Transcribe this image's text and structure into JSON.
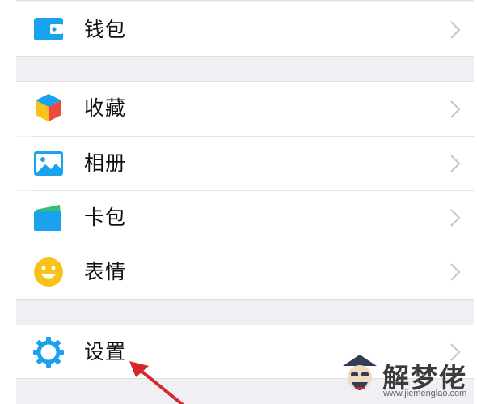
{
  "menu": {
    "items": [
      {
        "label": "钱包",
        "icon": "wallet-icon"
      },
      {
        "label": "收藏",
        "icon": "favorites-cube-icon"
      },
      {
        "label": "相册",
        "icon": "album-icon"
      },
      {
        "label": "卡包",
        "icon": "card-pack-icon"
      },
      {
        "label": "表情",
        "icon": "sticker-smiley-icon"
      },
      {
        "label": "设置",
        "icon": "settings-gear-icon"
      }
    ]
  },
  "watermark": {
    "title": "解梦佬",
    "url": "www.jiemenglao.com"
  },
  "colors": {
    "background": "#efeff4",
    "row": "#ffffff",
    "accent_blue": "#1aa2ef",
    "smiley_yellow": "#f8c21b",
    "arrow_red": "#d8262a"
  }
}
